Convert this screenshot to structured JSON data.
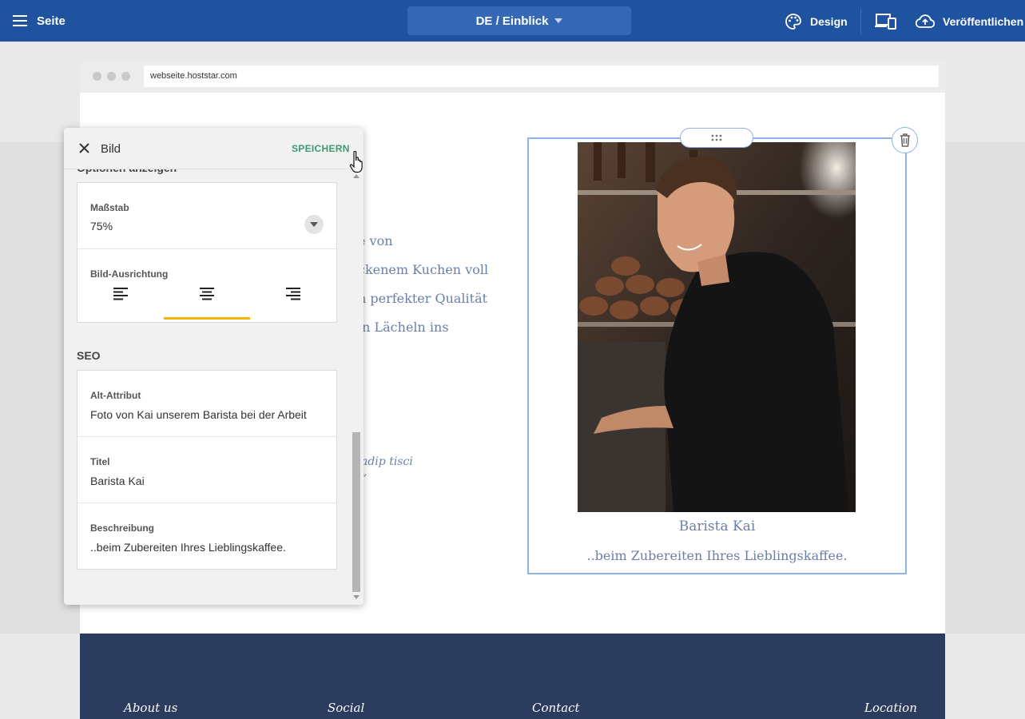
{
  "topbar": {
    "page_label": "Seite",
    "page_select": "DE / Einblick",
    "design_label": "Design",
    "publish_label": "Veröffentlichen"
  },
  "browser": {
    "url": "webseite.hoststar.com"
  },
  "page": {
    "text_lines": [
      "e von",
      "ckenem Kuchen voll",
      "n perfekter Qualität",
      "in Lächeln ins"
    ],
    "quote_fragment": "adip tisci",
    "quote_mark": "”",
    "image_caption_title": "Barista Kai",
    "image_caption_desc": "..beim Zubereiten Ihres Lieblingskaffee."
  },
  "footer": {
    "columns": [
      "About us",
      "Social",
      "Contact",
      "Location"
    ]
  },
  "panel": {
    "title": "Bild",
    "save_label": "SPEICHERN",
    "section_display_cut": "Optionen anzeigen",
    "scale_label": "Maßstab",
    "scale_value": "75%",
    "alignment_label": "Bild-Ausrichtung",
    "alignment_selected": "center",
    "seo_title": "SEO",
    "alt_label": "Alt-Attribut",
    "alt_value": "Foto von Kai unserem Barista bei der Arbeit",
    "title_label": "Titel",
    "title_value": "Barista Kai",
    "desc_label": "Beschreibung",
    "desc_value": "..beim Zubereiten Ihres Lieblingskaffee."
  },
  "colors": {
    "topbar": "#1f53a0",
    "accent_save": "#3d9a75",
    "align_underline": "#f4b400",
    "footer": "#2b3c5e",
    "selection": "#8fb3e8"
  },
  "icons": [
    "menu-icon",
    "palette-icon",
    "devices-icon",
    "cloud-upload-icon",
    "close-icon",
    "trash-icon",
    "drag-dots-icon",
    "align-left-icon",
    "align-center-icon",
    "align-right-icon",
    "hand-cursor-icon"
  ]
}
